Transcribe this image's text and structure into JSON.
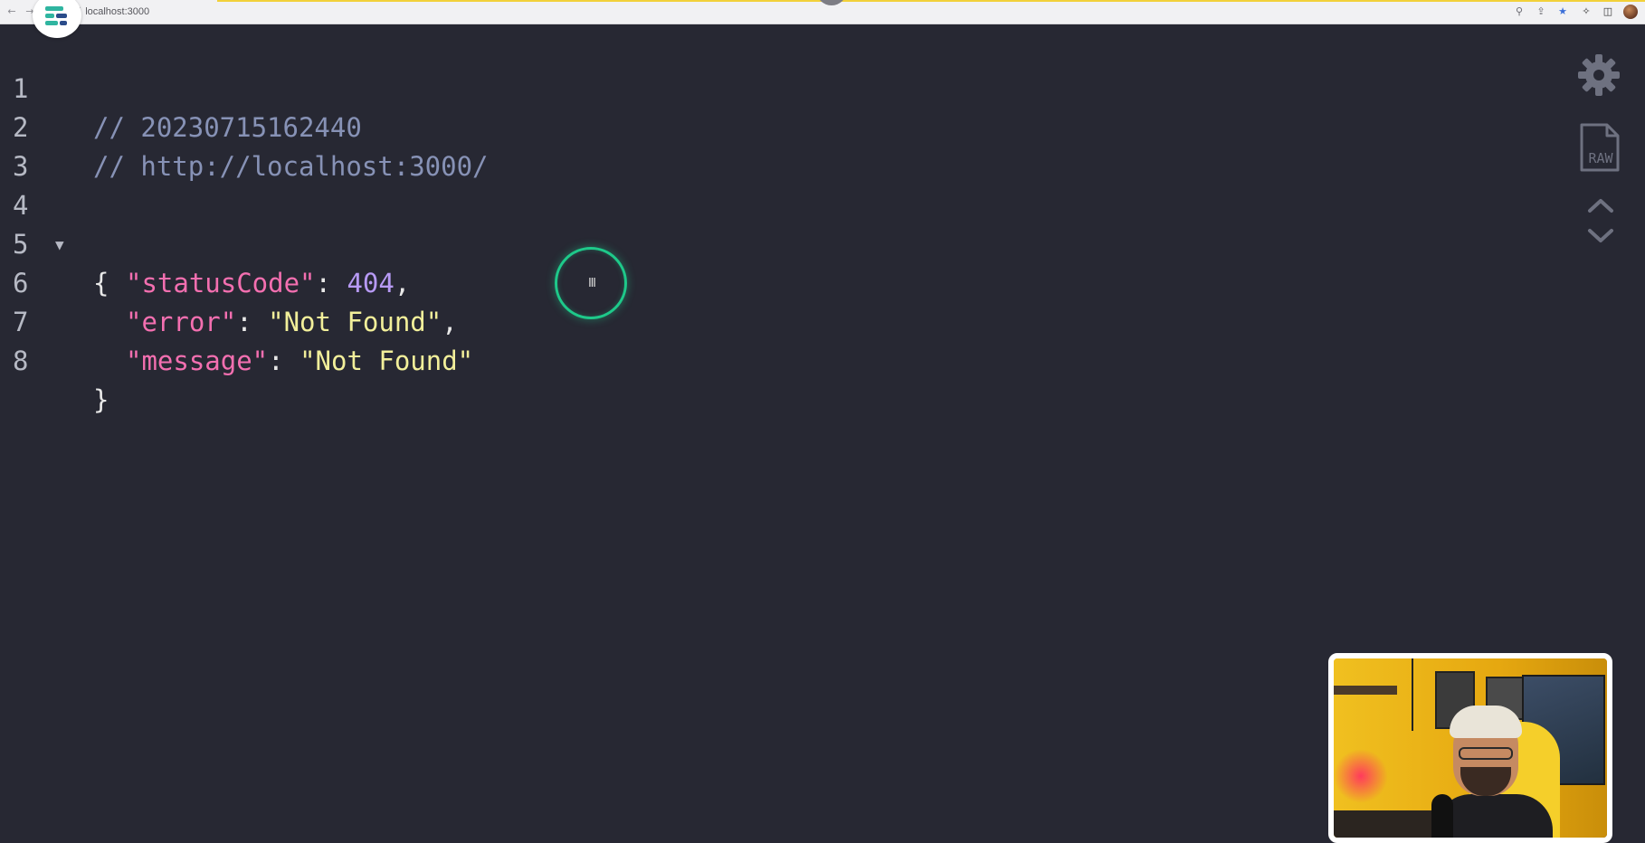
{
  "browser": {
    "url": "localhost:3000"
  },
  "code": {
    "lines": [
      {
        "number": "1",
        "comment": "// 20230715162440"
      },
      {
        "number": "2",
        "comment": "// http://localhost:3000/"
      },
      {
        "number": "3"
      },
      {
        "number": "4",
        "open_brace": "{"
      },
      {
        "number": "5",
        "key": "\"statusCode\"",
        "colon": ": ",
        "value": "404",
        "comma": ","
      },
      {
        "number": "6",
        "key": "\"error\"",
        "colon": ": ",
        "value": "\"Not Found\"",
        "comma": ","
      },
      {
        "number": "7",
        "key": "\"message\"",
        "colon": ": ",
        "value": "\"Not Found\""
      },
      {
        "number": "8",
        "close_brace": "}"
      }
    ]
  },
  "controls": {
    "raw_label": "RAW"
  },
  "colors": {
    "background": "#272833",
    "comment": "#8792b6",
    "key": "#f36fb0",
    "number": "#b79af5",
    "string": "#f2ef9a",
    "cursor_ring": "#1ec98a"
  },
  "icons": [
    "back-icon",
    "forward-icon",
    "app-logo",
    "zoom-icon",
    "share-icon",
    "bookmark-star-icon",
    "extensions-icon",
    "sidebar-icon",
    "profile-avatar",
    "gear-icon",
    "raw-file-icon",
    "chevron-up-icon",
    "chevron-down-icon",
    "fold-triangle-icon",
    "text-cursor-icon"
  ]
}
